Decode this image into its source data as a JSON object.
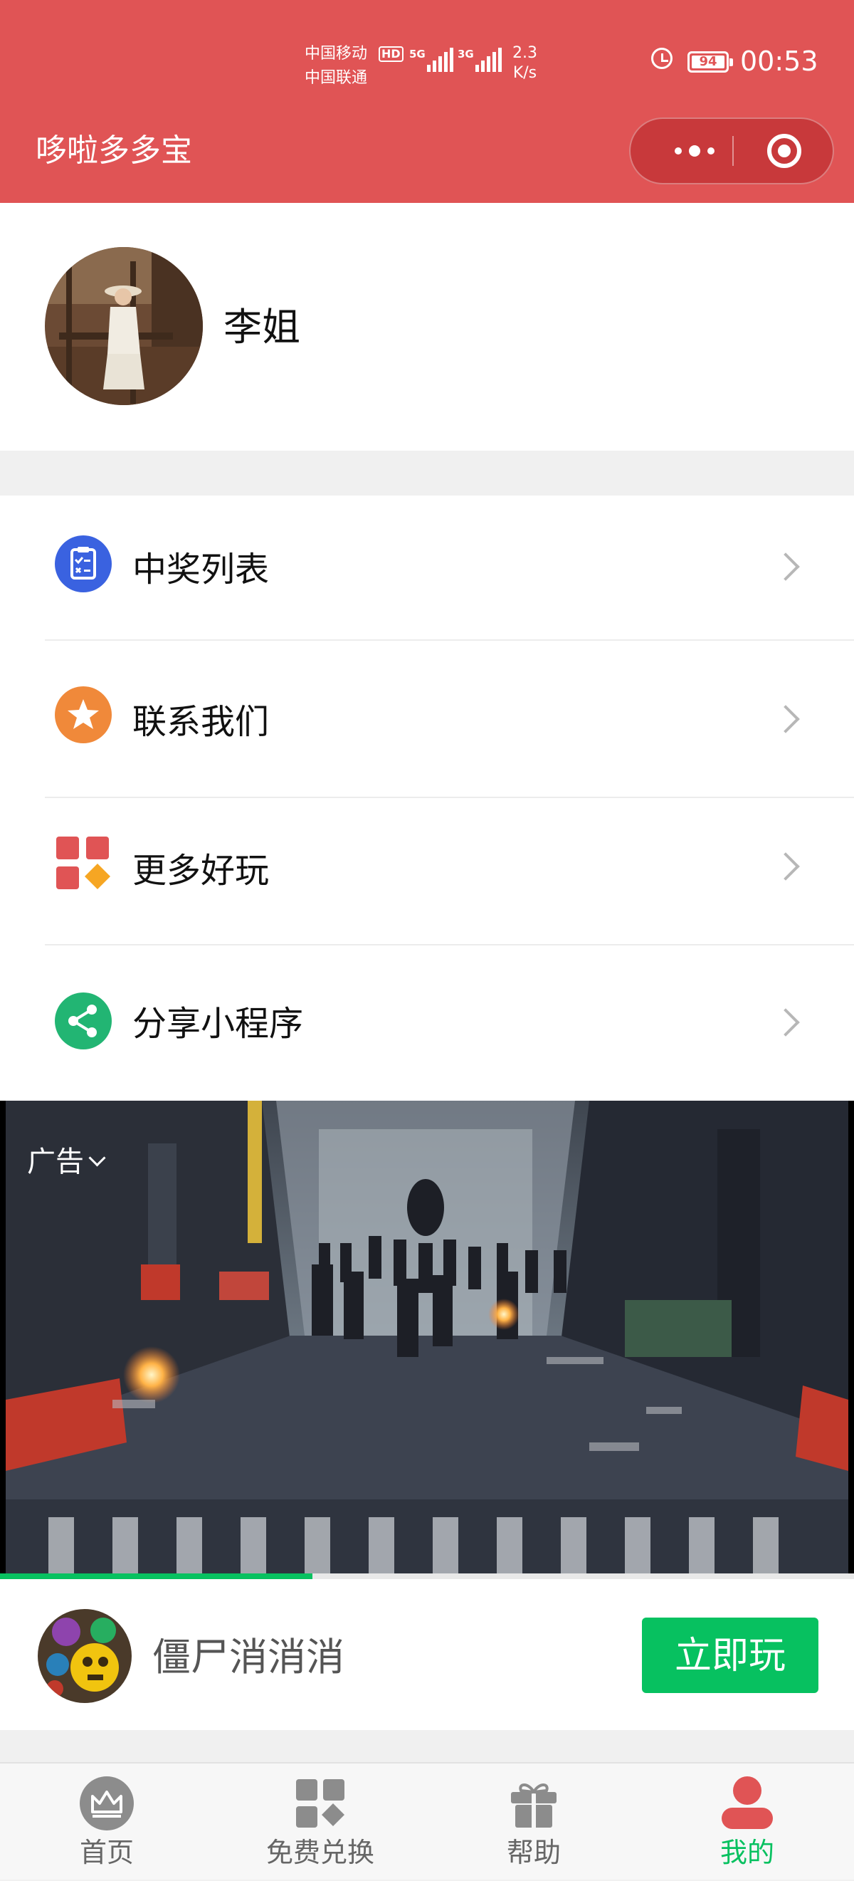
{
  "status_bar": {
    "carrier_1": "中国移动",
    "carrier_2": "中国联通",
    "hd": "HD",
    "net_1": "5G",
    "net_2": "3G",
    "speed_value": "2.3",
    "speed_unit": "K/s",
    "battery": "94",
    "time": "00:53"
  },
  "header": {
    "title": "哆啦多多宝",
    "background_color": "#e05455"
  },
  "profile": {
    "username": "李姐"
  },
  "menu": {
    "items": [
      {
        "label": "中奖列表",
        "icon": "prize-list-icon",
        "color": "#3a62e0"
      },
      {
        "label": "联系我们",
        "icon": "star-icon",
        "color": "#f0893a"
      },
      {
        "label": "更多好玩",
        "icon": "more-apps-icon",
        "color": "#e05455"
      },
      {
        "label": "分享小程序",
        "icon": "share-icon",
        "color": "#22b573"
      }
    ]
  },
  "ad": {
    "tag": "广告",
    "progress": 0.366
  },
  "game": {
    "name": "僵尸消消消",
    "play_label": "立即玩",
    "accent": "#07c160"
  },
  "tabbar": {
    "active_color": "#07c160",
    "tabs": [
      {
        "label": "首页",
        "icon": "crown-icon"
      },
      {
        "label": "免费兑换",
        "icon": "exchange-icon"
      },
      {
        "label": "帮助",
        "icon": "gift-icon"
      },
      {
        "label": "我的",
        "icon": "user-icon"
      }
    ]
  }
}
